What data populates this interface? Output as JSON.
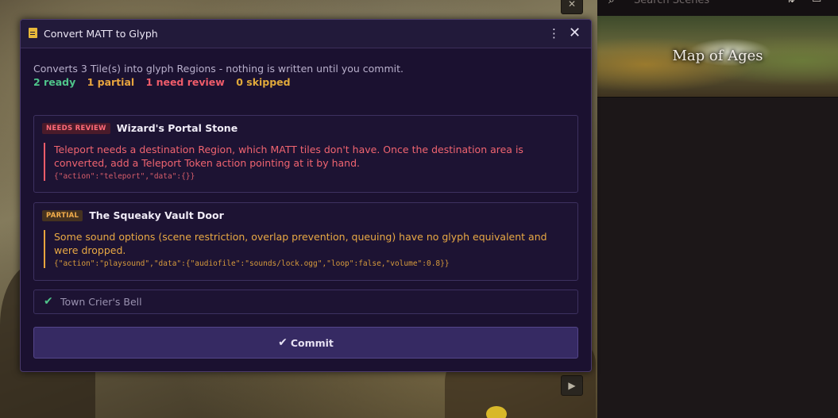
{
  "dialog": {
    "title": "Convert MATT to Glyph",
    "summary": "Converts 3 Tile(s) into glyph Regions - nothing is written until you commit.",
    "counts": {
      "ready": "2 ready",
      "partial": "1 partial",
      "review": "1 need review",
      "skipped": "0 skipped"
    },
    "items": [
      {
        "badge": "NEEDS REVIEW",
        "name": "Wizard's Portal Stone",
        "message": "Teleport needs a destination Region, which MATT tiles don't have. Once the destination area is converted, add a Teleport Token action pointing at it by hand.",
        "code": "{\"action\":\"teleport\",\"data\":{}}"
      },
      {
        "badge": "PARTIAL",
        "name": "The Squeaky Vault Door",
        "message": "Some sound options (scene restriction, overlap prevention, queuing) have no glyph equivalent and were dropped.",
        "code": "{\"action\":\"playsound\",\"data\":{\"audiofile\":\"sounds/lock.ogg\",\"loop\":false,\"volume\":0.8}}"
      },
      {
        "name": "Town Crier's Bell"
      }
    ],
    "commit_label": "Commit"
  },
  "sidebar": {
    "search_placeholder": "Search Scenes",
    "scene_name": "Map of Ages"
  },
  "colors": {
    "ready": "#4fc48a",
    "partial": "#e8a53e",
    "review": "#ef5c6a",
    "accent": "#362a63"
  },
  "icons": [
    "document-icon",
    "kebab-menu-icon",
    "close-icon",
    "check-icon",
    "search-icon",
    "sort-icon",
    "collapse-icon"
  ]
}
